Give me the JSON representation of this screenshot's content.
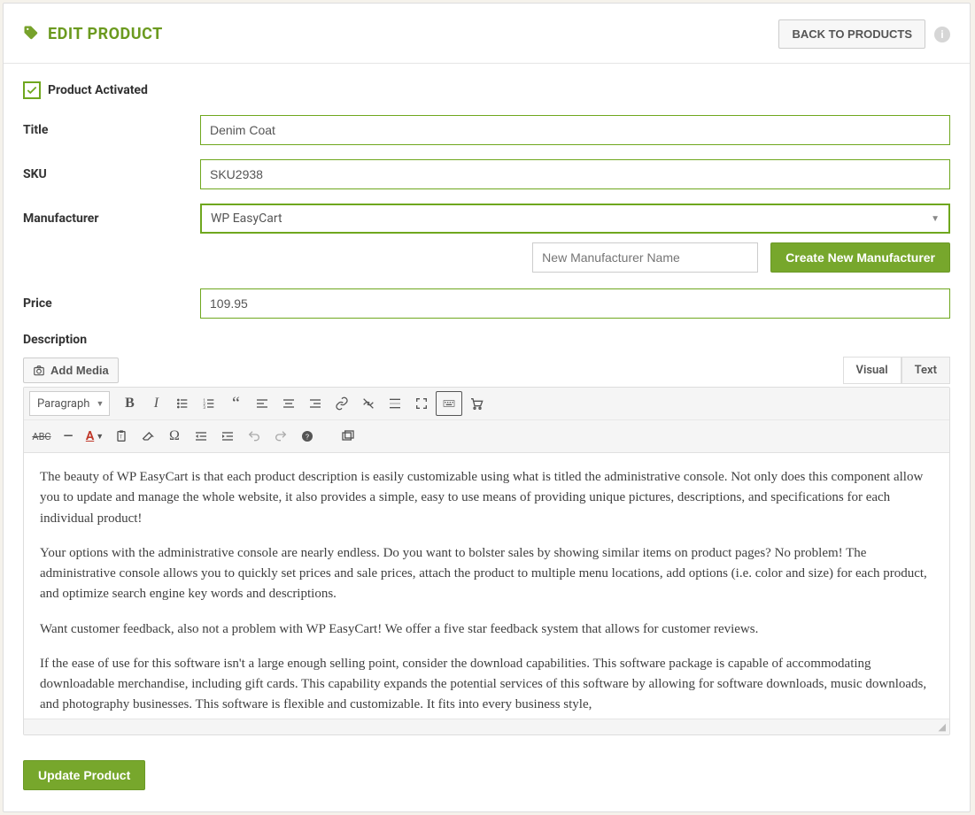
{
  "header": {
    "title": "EDIT PRODUCT",
    "back_label": "BACK TO PRODUCTS"
  },
  "checkbox": {
    "label": "Product Activated",
    "checked": true
  },
  "fields": {
    "title_label": "Title",
    "title_value": "Denim Coat",
    "sku_label": "SKU",
    "sku_value": "SKU2938",
    "manufacturer_label": "Manufacturer",
    "manufacturer_value": "WP EasyCart",
    "price_label": "Price",
    "price_value": "109.95",
    "description_label": "Description"
  },
  "manufacturer_actions": {
    "new_placeholder": "New Manufacturer Name",
    "create_label": "Create New Manufacturer"
  },
  "media": {
    "add_label": "Add Media"
  },
  "editor": {
    "tabs": {
      "visual": "Visual",
      "text": "Text"
    },
    "format_select": "Paragraph",
    "content": {
      "p1": "The beauty of WP EasyCart is that each product description is easily customizable using what is titled the administrative console. Not only does this component allow you to update and manage the whole website, it also provides a simple, easy to use means of providing unique pictures, descriptions, and specifications for each individual product!",
      "p2": "Your options with the administrative console are nearly endless. Do you want to bolster sales by showing similar items on product pages? No problem! The administrative console allows you to quickly set prices and sale prices, attach the product to multiple menu locations, add options (i.e. color and size) for each product, and optimize search engine key words and descriptions.",
      "p3": "Want customer feedback, also not a problem with WP EasyCart! We offer a five star feedback system that allows for customer reviews.",
      "p4": "If the ease of use for this software isn't a large enough selling point, consider the download capabilities. This software package is capable of accommodating downloadable merchandise, including gift cards. This capability expands the potential services of this software by allowing for software downloads, music downloads, and photography businesses. This software is flexible and customizable. It fits into every business style,"
    }
  },
  "footer": {
    "update_label": "Update Product"
  },
  "icons": {
    "tag": "tag-icon",
    "info": "i"
  },
  "toolbar_row1": [
    "bold-icon",
    "italic-icon",
    "ul-icon",
    "ol-icon",
    "quote-icon",
    "align-left-icon",
    "align-center-icon",
    "align-right-icon",
    "link-icon",
    "unlink-icon",
    "more-icon",
    "fullscreen-icon",
    "keyboard-icon",
    "cart-icon"
  ],
  "toolbar_row2": [
    "strike-icon",
    "hr-icon",
    "textcolor-icon",
    "paste-icon",
    "eraser-icon",
    "specialchar-icon",
    "outdent-icon",
    "indent-icon",
    "undo-icon",
    "redo-icon",
    "help-icon",
    "gallery-icon"
  ]
}
